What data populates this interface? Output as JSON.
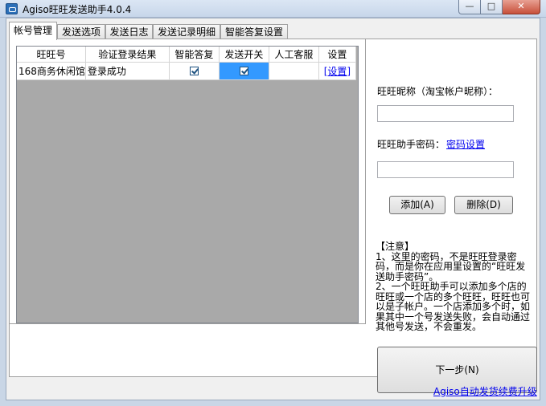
{
  "window": {
    "title": "Agiso旺旺发送助手4.0.4",
    "min_glyph": "—",
    "max_glyph": "□",
    "close_glyph": "✕"
  },
  "tabs": [
    {
      "label": "帐号管理",
      "active": true
    },
    {
      "label": "发送选项",
      "active": false
    },
    {
      "label": "发送日志",
      "active": false
    },
    {
      "label": "发送记录明细",
      "active": false
    },
    {
      "label": "智能答复设置",
      "active": false
    }
  ],
  "grid": {
    "columns": [
      "旺旺号",
      "验证登录结果",
      "智能答复",
      "发送开关",
      "人工客服",
      "设置"
    ],
    "rows": [
      {
        "account": "168商务休闲馆",
        "login_result": "登录成功",
        "smart_reply": true,
        "send_switch": true,
        "manual_service": "",
        "settings": "[设置]"
      }
    ]
  },
  "form": {
    "nickname_label": "旺旺昵称（淘宝帐户昵称）：",
    "nickname_value": "",
    "password_label": "旺旺助手密码：",
    "password_link": "密码设置",
    "password_value": "",
    "add_button": "添加(A)",
    "delete_button": "删除(D)"
  },
  "notice": {
    "title": "【注意】",
    "line1": "1、这里的密码，不是旺旺登录密码，而是你在应用里设置的“旺旺发送助手密码”。",
    "line2": "2、一个旺旺助手可以添加多个店的旺旺或一个店的多个旺旺，旺旺也可以是子帐户。一个店添加多个时，如果其中一个号发送失败，会自动通过其他号发送，不会重发。"
  },
  "next_button": "下一步(N)",
  "footer_link": "Agiso自动发货续费升级",
  "colors": {
    "selection": "#3399ff",
    "link": "#0000ee",
    "grid_empty": "#a9a9a9"
  }
}
